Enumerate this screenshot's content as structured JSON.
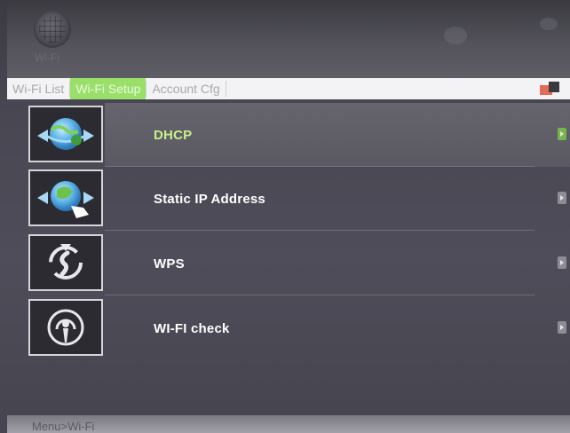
{
  "header": {
    "logo_caption": "Wi-Fi"
  },
  "tabs": [
    {
      "label": "Wi-Fi List",
      "active": false
    },
    {
      "label": "Wi-Fi Setup",
      "active": true
    },
    {
      "label": "Account Cfg",
      "active": false
    }
  ],
  "menu": {
    "items": [
      {
        "label": "DHCP",
        "icon": "globe-arrows-icon",
        "selected": true
      },
      {
        "label": "Static IP Address",
        "icon": "globe-hand-icon",
        "selected": false
      },
      {
        "label": "WPS",
        "icon": "refresh-wps-icon",
        "selected": false
      },
      {
        "label": "WI-FI check",
        "icon": "wifi-signal-icon",
        "selected": false
      }
    ]
  },
  "footer": {
    "breadcrumb": "Menu>Wi-Fi"
  },
  "colors": {
    "accent_green": "#9adf6a",
    "selected_text": "#c8f08a",
    "background": "#4e4d59"
  }
}
